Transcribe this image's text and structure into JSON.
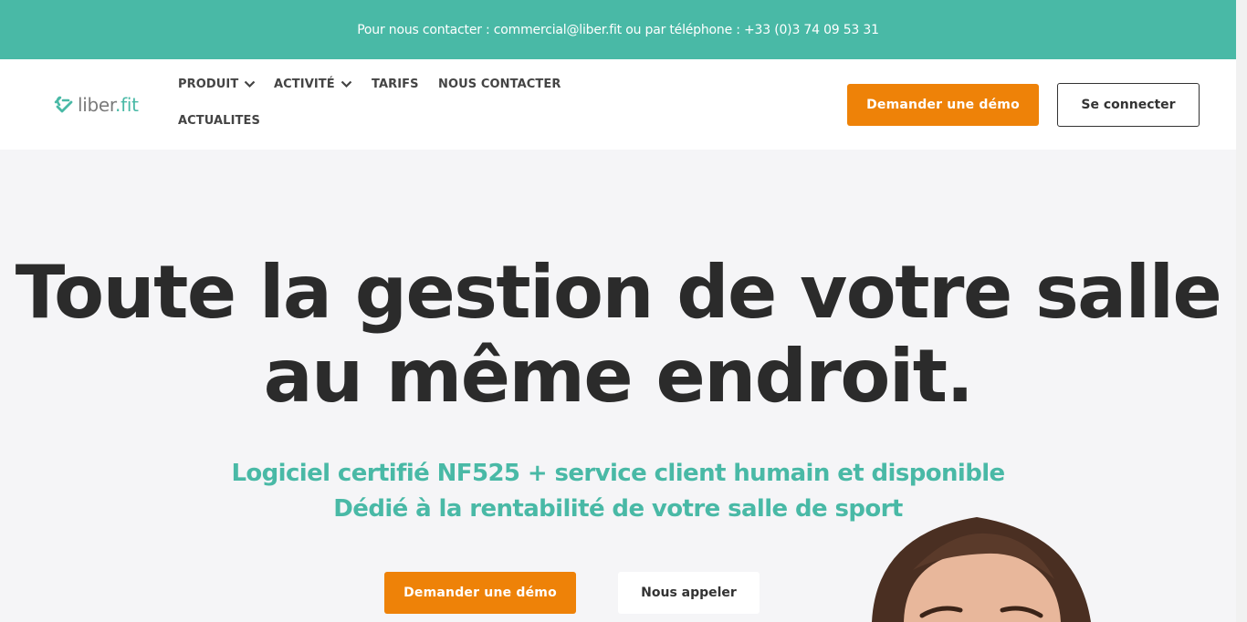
{
  "topbar": {
    "contact_text": "Pour nous contacter : commercial@liber.fit ou par téléphone : +33 (0)3 74 09 53 31"
  },
  "brand": {
    "name_part1": "liber",
    "name_dot": ".",
    "name_part2": "fit",
    "accent_color": "#49b9a6"
  },
  "nav": {
    "produit": "PRODUIT",
    "activite": "ACTIVITÉ",
    "tarifs": "TARIFS",
    "contact": "NOUS CONTACTER",
    "actualites": "ACTUALITES"
  },
  "header_buttons": {
    "demo": "Demander une démo",
    "login": "Se connecter"
  },
  "hero": {
    "title_line1": "Toute la gestion de votre salle",
    "title_line2": "au même endroit.",
    "subtitle_line1": "Logiciel certifié NF525 + service client humain et disponible",
    "subtitle_line2": "Dédié à la rentabilité de votre salle de sport",
    "cta_demo": "Demander une démo",
    "cta_call": "Nous appeler"
  },
  "colors": {
    "teal": "#49b9a6",
    "orange": "#ee8208",
    "dark": "#2b2b2b"
  }
}
